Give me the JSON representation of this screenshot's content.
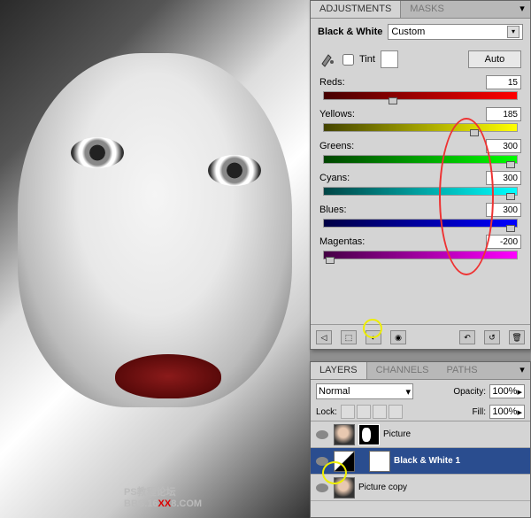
{
  "watermark": {
    "line1": "PS教程论坛",
    "line2_prefix": "BBS.16",
    "line2_red": "XX",
    "line2_suffix": "8.COM"
  },
  "adjustments": {
    "tabs": {
      "adjustments": "ADJUSTMENTS",
      "masks": "MASKS"
    },
    "title": "Black & White",
    "preset": "Custom",
    "tint_label": "Tint",
    "auto": "Auto",
    "sliders": {
      "reds": {
        "label": "Reds:",
        "value": "15",
        "pos": 36
      },
      "yellows": {
        "label": "Yellows:",
        "value": "185",
        "pos": 78
      },
      "greens": {
        "label": "Greens:",
        "value": "300",
        "pos": 97
      },
      "cyans": {
        "label": "Cyans:",
        "value": "300",
        "pos": 97
      },
      "blues": {
        "label": "Blues:",
        "value": "300",
        "pos": 97
      },
      "magentas": {
        "label": "Magentas:",
        "value": "-200",
        "pos": 3
      }
    }
  },
  "layers": {
    "tabs": {
      "layers": "LAYERS",
      "channels": "CHANNELS",
      "paths": "PATHS"
    },
    "blend": "Normal",
    "opacity_label": "Opacity:",
    "opacity": "100%",
    "lock_label": "Lock:",
    "fill_label": "Fill:",
    "fill": "100%",
    "rows": {
      "r0": "Picture",
      "r1": "Black & White 1",
      "r2": "Picture copy"
    }
  }
}
